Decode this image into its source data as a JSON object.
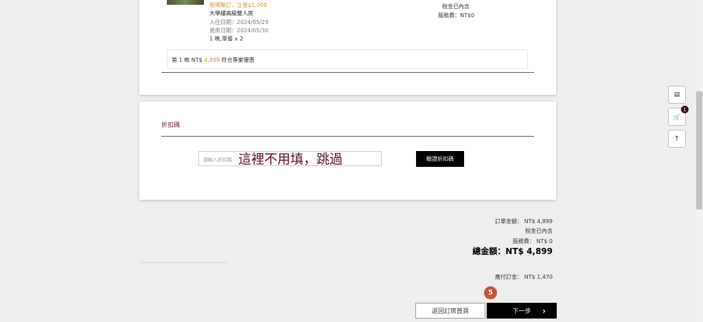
{
  "booking": {
    "promo_note": "現場聯訂，立省$1,000",
    "room_name": "大學樓高級雙人房",
    "checkin": "入住日期：2024/05/29",
    "checkout": "退房日期：2024/05/30",
    "nights_qty": "1 晚,單餐 x 2",
    "tax_included": "稅金已內含",
    "service_fee": "服務費：NT$0",
    "night_prefix": "第 1 晚 NT$ ",
    "night_price": "4,899",
    "night_suffix": " 符合專案優惠"
  },
  "discount": {
    "title": "折扣碼",
    "placeholder": "請輸入折扣碼",
    "overlay_note": "這裡不用填，跳過",
    "apply_label": "驗證折扣碼"
  },
  "summary": {
    "order_amount": "訂單金額： NT$ 4,899",
    "tax_included": "稅金已內含",
    "service_fee": "服務費： NT$ 0",
    "total": "總金額：NT$ 4,899",
    "deposit": "應付訂金： NT$ 1,470"
  },
  "step_badge": "5",
  "buttons": {
    "back": "返回訂房首頁",
    "next": "下一步",
    "next_arrow": "›"
  },
  "sidebar": {
    "cart_count": "1",
    "chat_icon": "▤",
    "cart_icon": "🛒",
    "top_icon": "↑"
  }
}
